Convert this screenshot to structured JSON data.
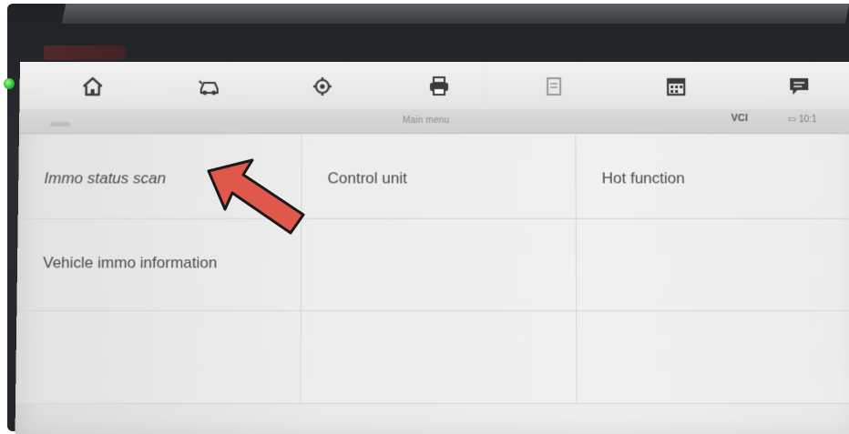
{
  "toolbar": {
    "icons": [
      "home-icon",
      "car-icon",
      "gear-icon",
      "printer-icon",
      "document-icon",
      "calendar-icon",
      "chat-icon"
    ]
  },
  "subbar": {
    "title": "Main menu",
    "vci": "VCI",
    "battery": "▭ 10:1"
  },
  "menu": {
    "items": [
      {
        "label": "Immo status scan"
      },
      {
        "label": "Control unit"
      },
      {
        "label": "Hot function"
      },
      {
        "label": "Vehicle immo information"
      }
    ]
  },
  "colors": {
    "arrow_fill": "#e0584b",
    "arrow_stroke": "#1a1a1a",
    "bezel": "#23262a",
    "screen": "#e7e7e7"
  }
}
